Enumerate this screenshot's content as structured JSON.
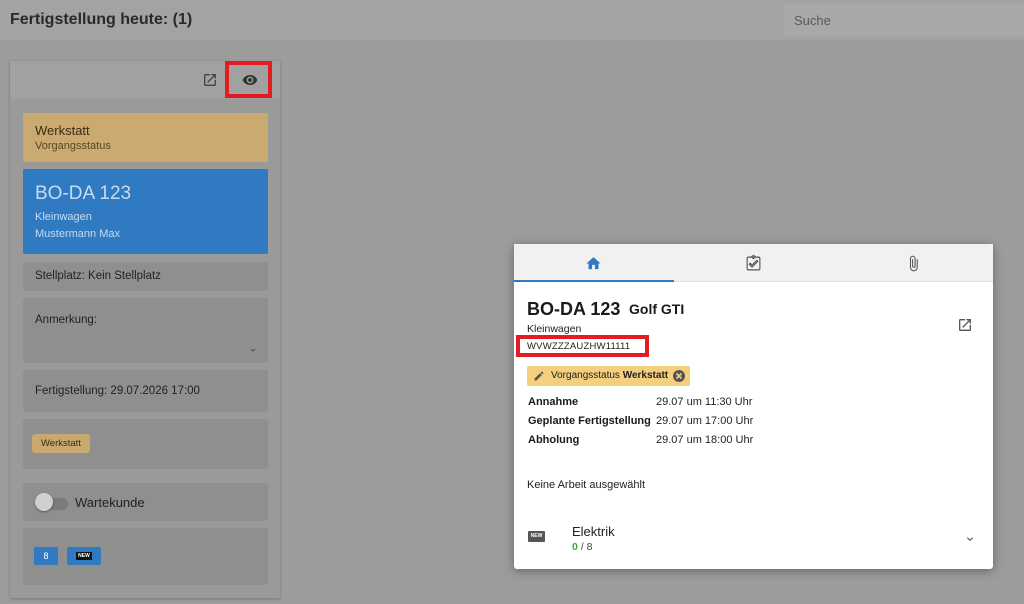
{
  "header": {
    "title": "Fertigstellung heute: (1)",
    "search_placeholder": "Suche"
  },
  "card": {
    "status": {
      "value": "Werkstatt",
      "label": "Vorgangsstatus"
    },
    "vehicle": {
      "plate": "BO-DA 123",
      "class": "Kleinwagen",
      "owner": "Mustermann Max"
    },
    "parking": "Stellplatz: Kein Stellplatz",
    "note_label": "Anmerkung:",
    "completion": "Fertigstellung: 29.07.2026 17:00",
    "status_tag": "Werkstatt",
    "waiting_customer": {
      "label": "Wartekunde",
      "on": false
    },
    "badge_count": "8",
    "badge_new": "NEW"
  },
  "popup": {
    "tabs": [
      "home-icon",
      "clipboard-check-icon",
      "paperclip-icon"
    ],
    "active_tab": 0,
    "plate": "BO-DA 123",
    "model": "Golf GTI",
    "class": "Kleinwagen",
    "vin": "WVWZZZAUZHW11111",
    "status_chip": {
      "label": "Vorgangsstatus",
      "value": "Werkstatt"
    },
    "info": [
      {
        "label": "Annahme",
        "value": "29.07 um 11:30 Uhr"
      },
      {
        "label": "Geplante Fertigstellung",
        "value": "29.07 um 17:00 Uhr"
      },
      {
        "label": "Abholung",
        "value": "29.07 um 18:00 Uhr"
      }
    ],
    "no_work": "Keine Arbeit ausgewählt",
    "job": {
      "name": "Elektrik",
      "done": "0",
      "total": "/ 8",
      "icon_text": "NEW"
    }
  },
  "colors": {
    "accent": "#2f7ac0",
    "status_bg": "#f3cf7e",
    "highlight": "#e31b23",
    "done": "#3fa53f"
  }
}
